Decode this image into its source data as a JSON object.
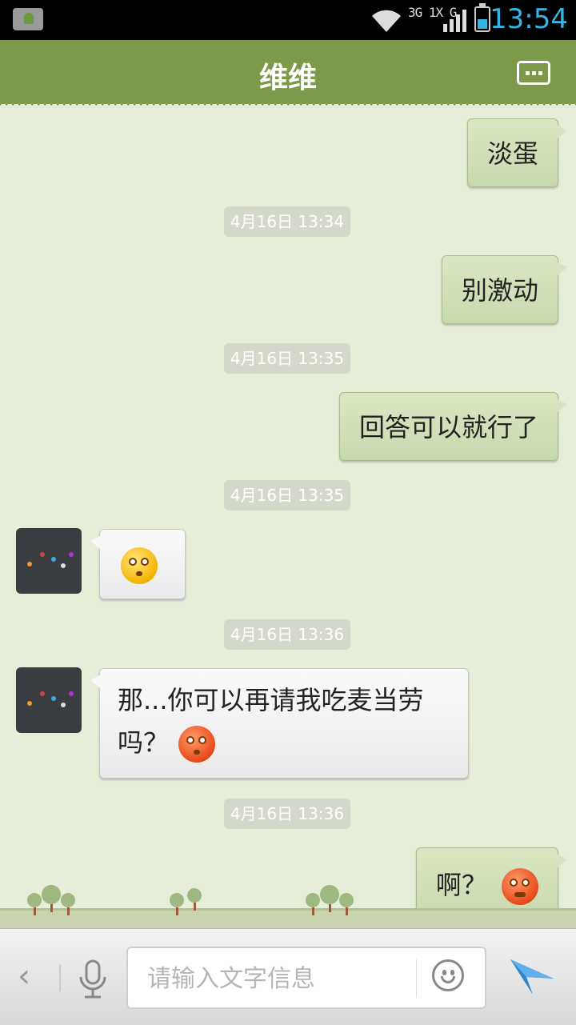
{
  "status_bar": {
    "network_label": "3G 1X G",
    "clock": "13:54",
    "accent_color": "#33b5e5"
  },
  "header": {
    "title": "维维",
    "menu_icon": "more-dots-icon",
    "color": "#7d9a4a"
  },
  "messages": [
    {
      "type": "outgoing",
      "text": "淡蛋"
    },
    {
      "type": "timestamp",
      "text": "4月16日 13:34"
    },
    {
      "type": "outgoing",
      "text": "别激动"
    },
    {
      "type": "timestamp",
      "text": "4月16日 13:35"
    },
    {
      "type": "outgoing",
      "text": "回答可以就行了"
    },
    {
      "type": "timestamp",
      "text": "4月16日 13:35"
    },
    {
      "type": "incoming",
      "emoji": "dizzy-face-emoji"
    },
    {
      "type": "timestamp",
      "text": "4月16日 13:36"
    },
    {
      "type": "incoming",
      "text_line1": "那...你可以再请我吃麦当劳",
      "text_line2": "吗？",
      "emoji": "red-face-emoji"
    },
    {
      "type": "timestamp",
      "text": "4月16日 13:36"
    },
    {
      "type": "outgoing",
      "text": "啊？",
      "emoji": "angry-red-face-emoji"
    }
  ],
  "input_bar": {
    "back_glyph": "‹",
    "placeholder": "请输入文字信息",
    "mic_icon": "microphone-icon",
    "emoji_icon": "smiley-icon",
    "send_icon": "send-arrow-icon"
  },
  "colors": {
    "outgoing_bubble": "#d2e0b8",
    "incoming_bubble": "#f4f4f4",
    "chat_background": "#e6eed9"
  }
}
